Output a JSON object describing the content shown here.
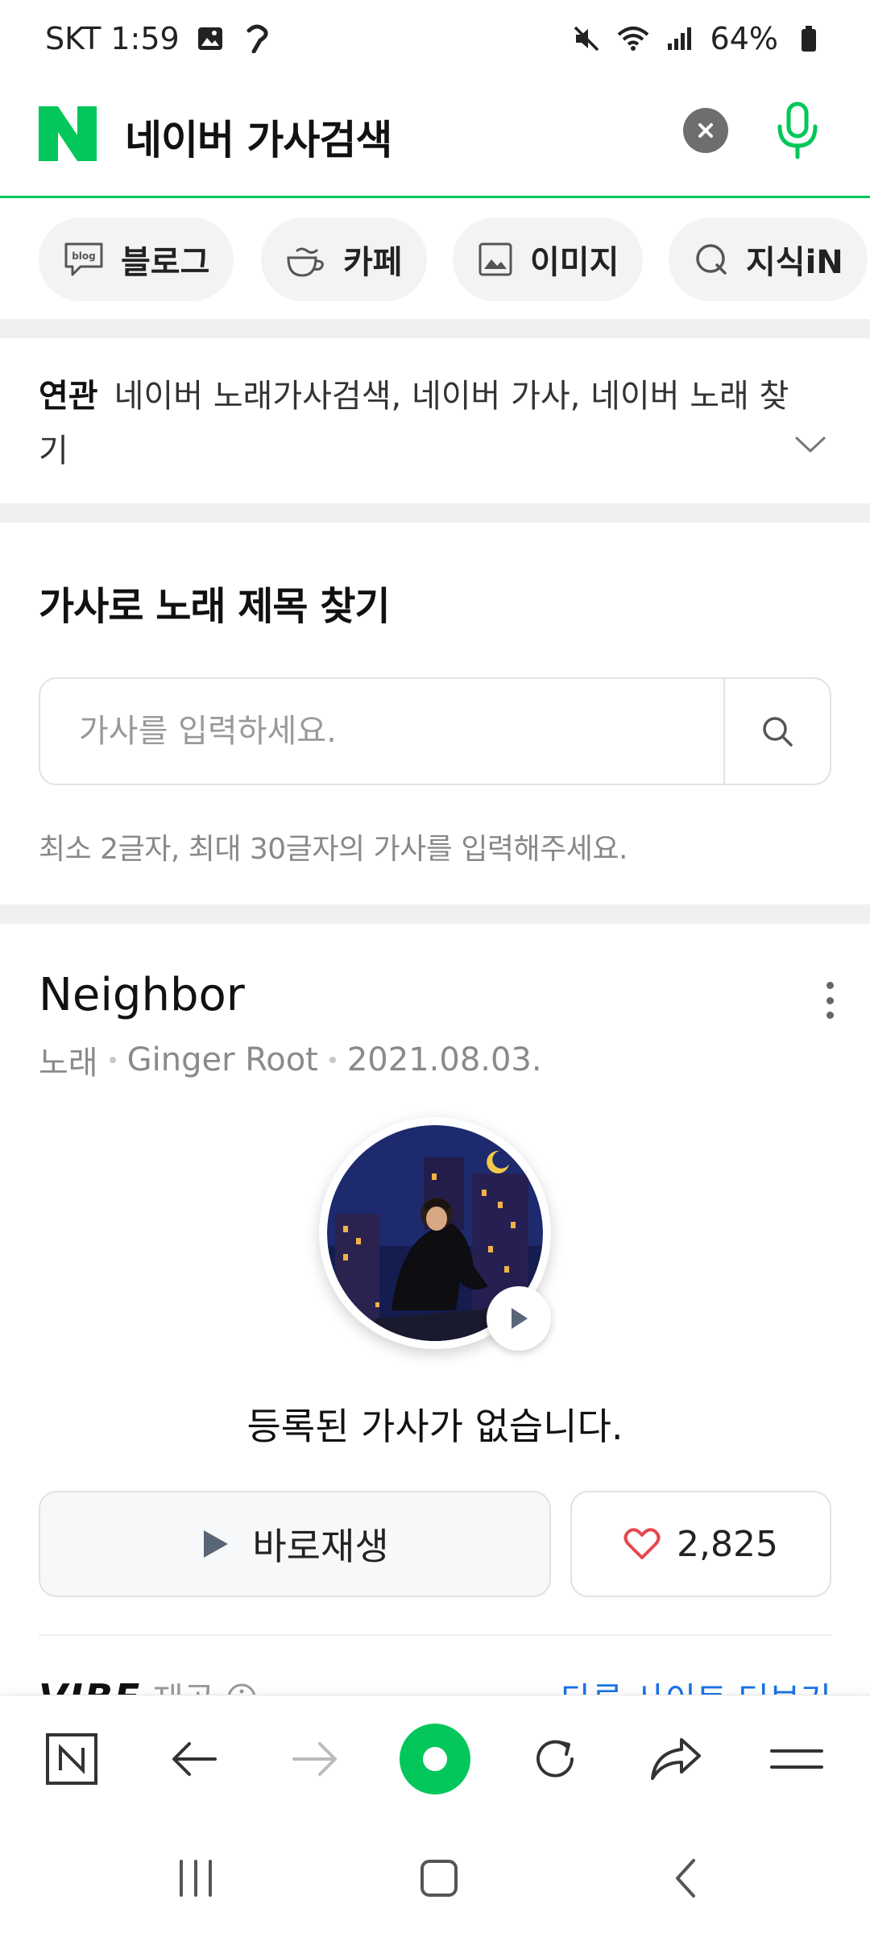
{
  "status_bar": {
    "carrier_time": "SKT 1:59",
    "battery": "64%"
  },
  "search": {
    "query": "네이버 가사검색"
  },
  "tabs": [
    {
      "label": "블로그",
      "icon": "blog-icon"
    },
    {
      "label": "카페",
      "icon": "cafe-cup-icon"
    },
    {
      "label": "이미지",
      "icon": "image-icon"
    },
    {
      "label": "지식iN",
      "icon": "kin-q-icon"
    }
  ],
  "related": {
    "label": "연관",
    "text": "네이버 노래가사검색, 네이버 가사, 네이버 노래 찾기"
  },
  "lyrics_search": {
    "title": "가사로 노래 제목 찾기",
    "placeholder": "가사를 입력하세요.",
    "hint": "최소 2글자, 최대 30글자의 가사를 입력해주세요."
  },
  "song": {
    "title": "Neighbor",
    "type": "노래",
    "artist": "Ginger Root",
    "date": "2021.08.03.",
    "no_lyrics": "등록된 가사가 없습니다.",
    "play_label": "바로재생",
    "likes": "2,825"
  },
  "vibe": {
    "logo": "VIBE",
    "provided": "제공",
    "more_sites": "다른 사이트 더보기"
  },
  "colors": {
    "accent": "#03c75a",
    "like": "#e5484d",
    "link": "#1a73e8"
  }
}
